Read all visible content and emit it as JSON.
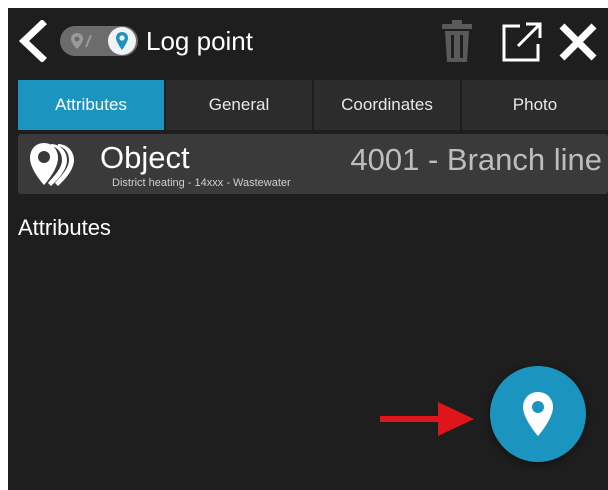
{
  "header": {
    "title": "Log point",
    "icons": [
      "back-icon",
      "map-icon",
      "location-pin-icon",
      "trash-icon",
      "open-external-icon",
      "close-icon"
    ]
  },
  "tabs": [
    {
      "label": "Attributes",
      "active": true
    },
    {
      "label": "General",
      "active": false
    },
    {
      "label": "Coordinates",
      "active": false
    },
    {
      "label": "Photo",
      "active": false
    }
  ],
  "object_card": {
    "label": "Object",
    "subtitle": "District heating - 14xxx - Wastewater",
    "value": "4001 - Branch line"
  },
  "section": {
    "heading": "Attributes"
  },
  "colors": {
    "accent": "#1b95bf",
    "background": "#1e1e1e",
    "card": "#3a3a3a",
    "tab": "#2c2c2c",
    "annotation_arrow": "#e0141b"
  }
}
